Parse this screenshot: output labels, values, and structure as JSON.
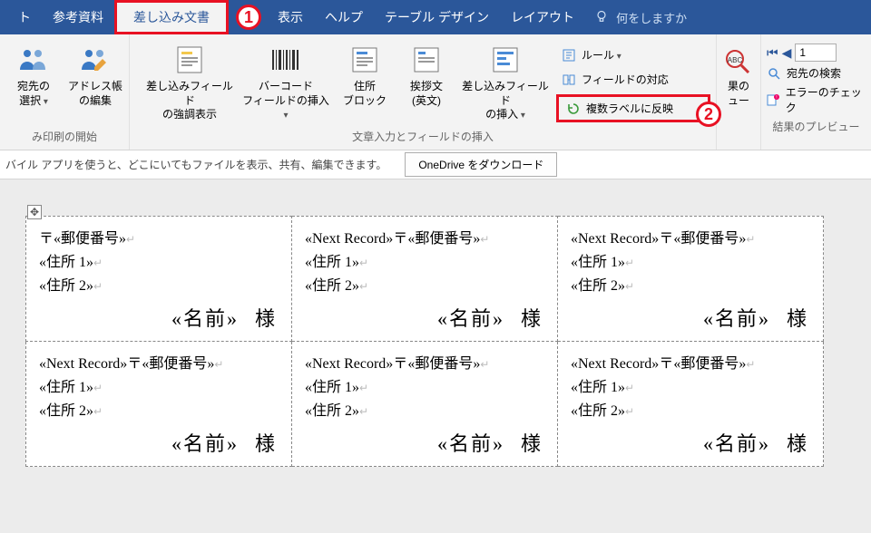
{
  "tabs": {
    "t0": "ト",
    "t1": "参考資料",
    "t2": "差し込み文書",
    "t3": "表示",
    "t4": "ヘルプ",
    "t5": "テーブル デザイン",
    "t6": "レイアウト",
    "tellme": "何をしますか"
  },
  "callouts": {
    "c1": "1",
    "c2": "2"
  },
  "ribbon": {
    "group1": {
      "label": "み印刷の開始",
      "btn1": "宛先の\n選択",
      "btn2": "アドレス帳\nの編集"
    },
    "group2": {
      "label": "文章入力とフィールドの挿入",
      "btn1": "差し込みフィールド\nの強調表示",
      "btn2": "バーコード\nフィールドの挿入",
      "btn3": "住所\nブロック",
      "btn4": "挨拶文\n(英文)",
      "btn5": "差し込みフィールド\nの挿入",
      "opt1": "ルール",
      "opt2": "フィールドの対応",
      "opt3": "複数ラベルに反映"
    },
    "group3": {
      "label": "",
      "btn": "果の\nュー"
    },
    "group4": {
      "label": "結果のプレビュー",
      "rec": "1",
      "item1": "宛先の検索",
      "item2": "エラーのチェック"
    }
  },
  "infobar": {
    "msg": "バイル アプリを使うと、どこにいてもファイルを表示、共有、編集できます。",
    "btn": "OneDrive をダウンロード"
  },
  "doc": {
    "postal_symbol": "〒",
    "next_record": "«Next Record»",
    "f_postal": "«郵便番号»",
    "f_addr1": "«住所 1»",
    "f_addr2": "«住所 2»",
    "f_name": "«名前»",
    "sama": "様",
    "ret": "↵"
  }
}
